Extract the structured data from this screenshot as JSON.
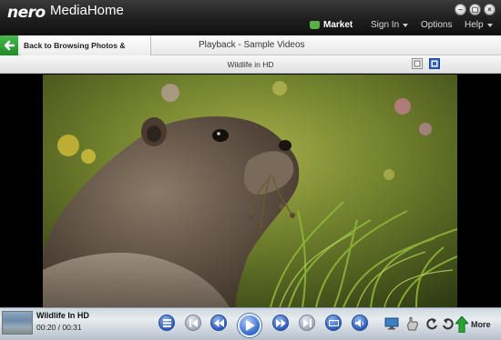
{
  "window": {
    "logo": "nero",
    "app_name": "MediaHome"
  },
  "menu": {
    "market": "Market",
    "sign_in": "Sign In",
    "options": "Options",
    "help": "Help"
  },
  "nav": {
    "back_label": "Back to Browsing Photos & Videos",
    "title": "Playback - Sample Videos"
  },
  "subtitle": "Wildlife in HD",
  "player": {
    "clip_title": "Wildlife In HD",
    "clip_time": "00:20 / 00:31",
    "more_label": "More"
  },
  "colors": {
    "accent_green": "#2aa534",
    "control_blue": "#2f5fbf",
    "titlebar": "#1c1c1c"
  },
  "icons": {
    "controls": [
      "stop-icon",
      "previous-icon",
      "rewind-icon",
      "play-icon",
      "fast-forward-icon",
      "next-icon",
      "aspect-icon",
      "volume-icon",
      "tv-output-icon",
      "rotate-left-icon",
      "rotate-right-icon",
      "more-arrow-icon"
    ]
  }
}
